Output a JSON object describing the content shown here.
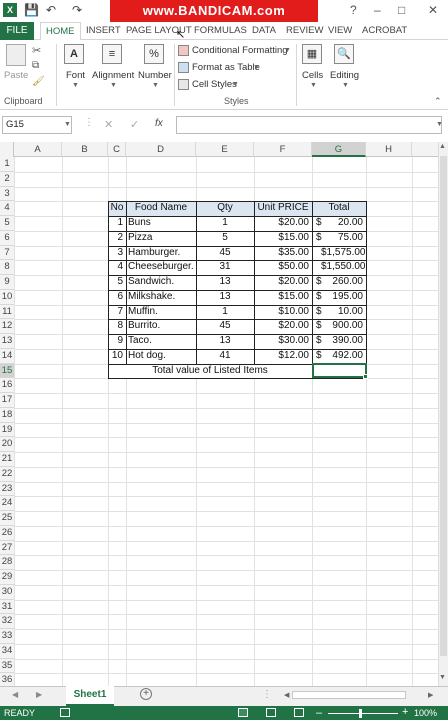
{
  "watermark": "www.BANDICAM.com",
  "titlebar": {
    "help": "?",
    "minimize": "–",
    "restore": "□",
    "close": "✕"
  },
  "tabs": [
    "FILE",
    "HOME",
    "INSERT",
    "PAGE LAYOUT",
    "FORMULAS",
    "DATA",
    "REVIEW",
    "VIEW",
    "ACROBAT"
  ],
  "active_tab": "HOME",
  "ribbon": {
    "clipboard": {
      "paste": "Paste",
      "group": "Clipboard"
    },
    "font": "Font",
    "alignment": "Alignment",
    "number": "Number",
    "number_icon": "%",
    "styles": {
      "conditional": "Conditional Formatting",
      "format_table": "Format as Table",
      "cell_styles": "Cell Styles",
      "group": "Styles"
    },
    "cells": "Cells",
    "editing": "Editing"
  },
  "formula_bar": {
    "name_box": "G15",
    "cancel": "✕",
    "enter": "✓",
    "fx": "fx",
    "formula": ""
  },
  "columns": [
    "A",
    "B",
    "C",
    "D",
    "E",
    "F",
    "G",
    "H"
  ],
  "selected_column": "G",
  "selected_row": 15,
  "rows": [
    "1",
    "2",
    "3",
    "4",
    "5",
    "6",
    "7",
    "8",
    "9",
    "10",
    "11",
    "12",
    "13",
    "14",
    "15",
    "16",
    "17",
    "18",
    "19",
    "20",
    "21",
    "22",
    "23",
    "24",
    "25",
    "26",
    "27",
    "28",
    "29",
    "30",
    "31",
    "32",
    "33",
    "34",
    "35",
    "36"
  ],
  "table": {
    "headers": [
      "No",
      "Food Name",
      "Qty",
      "Unit PRICE",
      "Total"
    ],
    "rows": [
      [
        "1",
        "Buns",
        "1",
        "$20.00",
        "$",
        "20.00"
      ],
      [
        "2",
        "Pizza",
        "5",
        "$15.00",
        "$",
        "75.00"
      ],
      [
        "3",
        "Hamburger.",
        "45",
        "$35.00",
        "",
        "$1,575.00"
      ],
      [
        "4",
        "Cheeseburger.",
        "31",
        "$50.00",
        "",
        "$1,550.00"
      ],
      [
        "5",
        "Sandwich.",
        "13",
        "$20.00",
        "$",
        "260.00"
      ],
      [
        "6",
        "Milkshake.",
        "13",
        "$15.00",
        "$",
        "195.00"
      ],
      [
        "7",
        "Muffin.",
        "1",
        "$10.00",
        "$",
        "10.00"
      ],
      [
        "8",
        "Burrito.",
        "45",
        "$20.00",
        "$",
        "900.00"
      ],
      [
        "9",
        "Taco.",
        "13",
        "$30.00",
        "$",
        "390.00"
      ],
      [
        "10",
        "Hot dog.",
        "41",
        "$12.00",
        "$",
        "492.00"
      ]
    ],
    "total_label": "Total value of Listed Items",
    "header_bg": "#dce6f1"
  },
  "sheet_tab": "Sheet1",
  "add_sheet": "+",
  "status": {
    "ready": "READY",
    "zoom": "100%"
  },
  "colors": {
    "accent": "#217346",
    "watermark": "#e21b1b"
  }
}
